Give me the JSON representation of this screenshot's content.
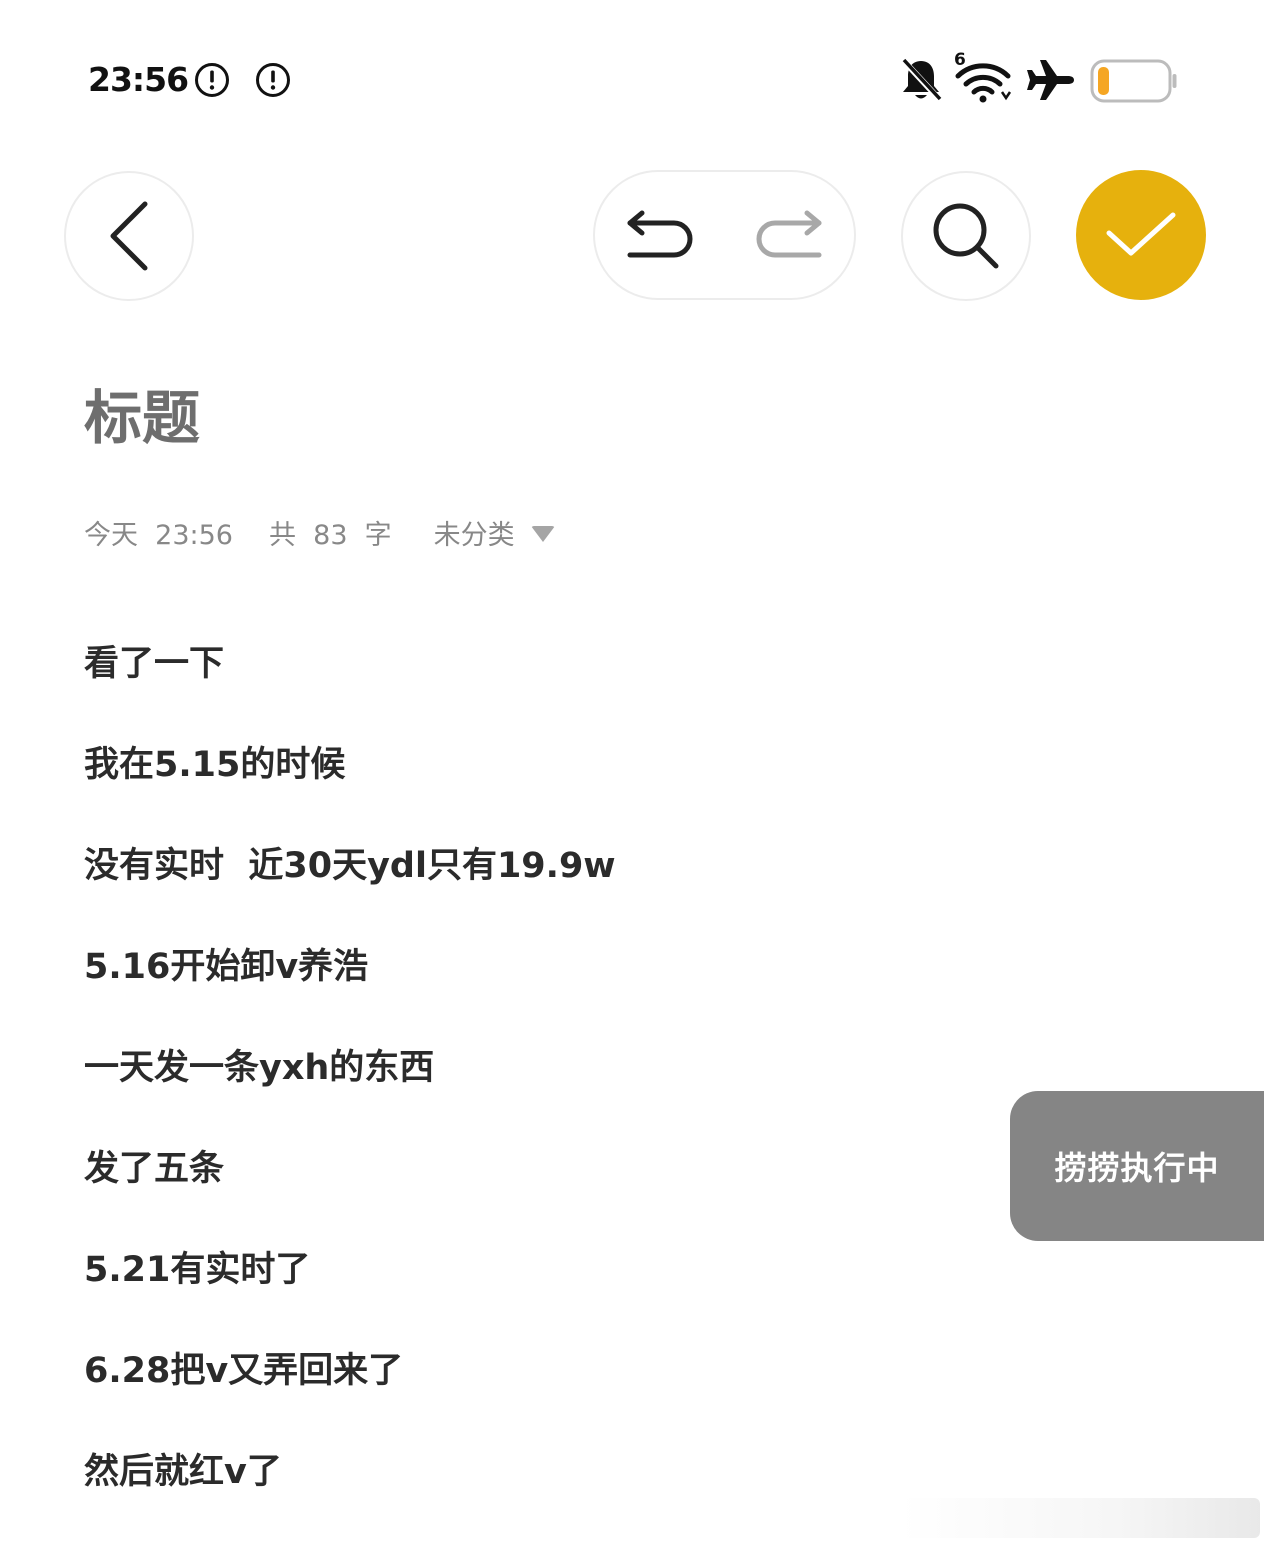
{
  "status_bar": {
    "time": "23:56",
    "icons": [
      "alert-circle-icon",
      "alert-circle-icon",
      "bell-muted-icon",
      "wifi-icon",
      "airplane-icon",
      "battery-low-icon"
    ],
    "wifi_badge": "6",
    "battery_color": "#f5a623"
  },
  "toolbar": {
    "back_icon": "chevron-left-icon",
    "undo_icon": "undo-icon",
    "redo_icon": "redo-icon",
    "search_icon": "search-icon",
    "done_icon": "checkmark-icon",
    "done_color": "#e6b10d"
  },
  "note": {
    "title": "标题",
    "meta": {
      "date": "今天  23:56",
      "count": "共  83  字",
      "category": "未分类"
    },
    "lines": [
      "看了一下",
      "我在5.15的时候",
      "没有实时  近30天ydl只有19.9w",
      "5.16开始卸v养浩",
      "一天发一条yxh的东西",
      "发了五条",
      "5.21有实时了",
      "6.28把v又弄回来了",
      "然后就红v了"
    ]
  },
  "floating_badge": {
    "label": "捞捞执行中"
  }
}
